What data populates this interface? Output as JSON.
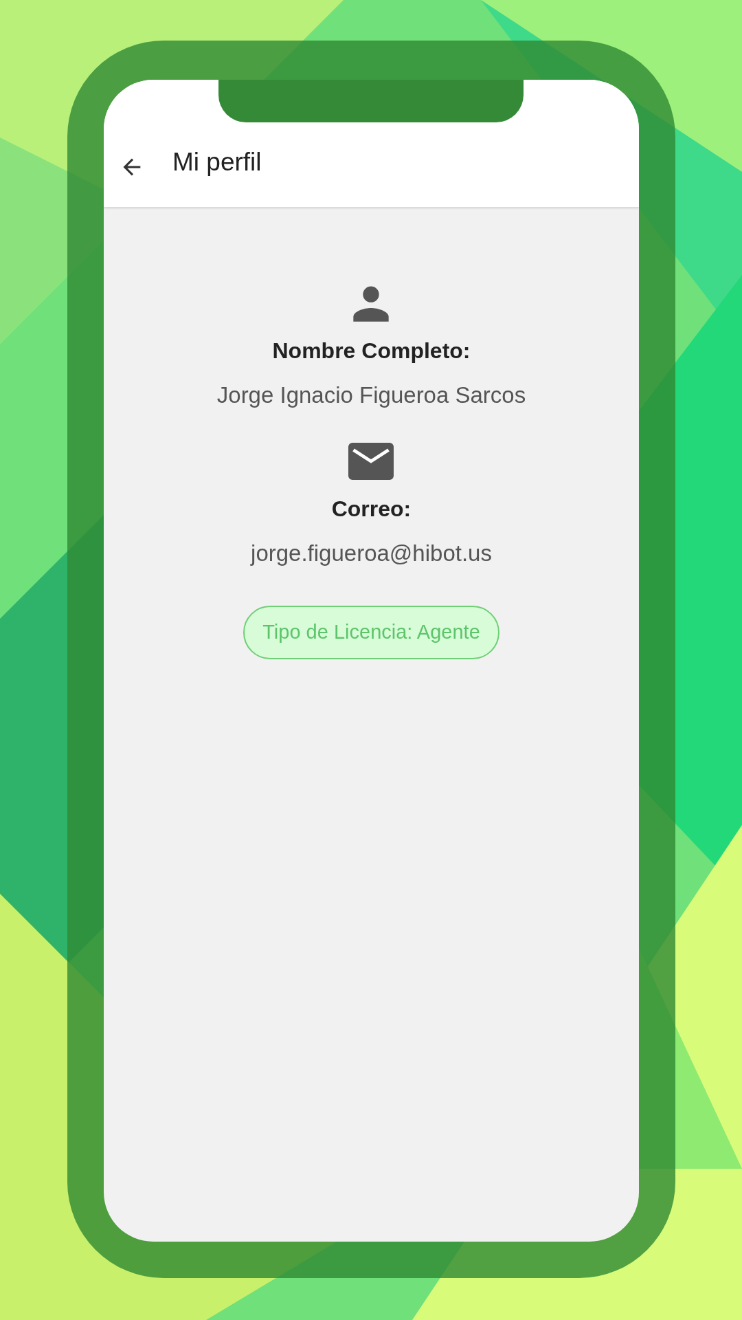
{
  "header": {
    "title": "Mi perfil"
  },
  "fields": [
    {
      "kind": "person",
      "label": "Nombre Completo:",
      "value": "Jorge Ignacio Figueroa Sarcos"
    },
    {
      "kind": "mail",
      "label": "Correo:",
      "value": "jorge.figueroa@hibot.us"
    }
  ],
  "license": {
    "label": "Tipo de Licencia: Agente"
  }
}
